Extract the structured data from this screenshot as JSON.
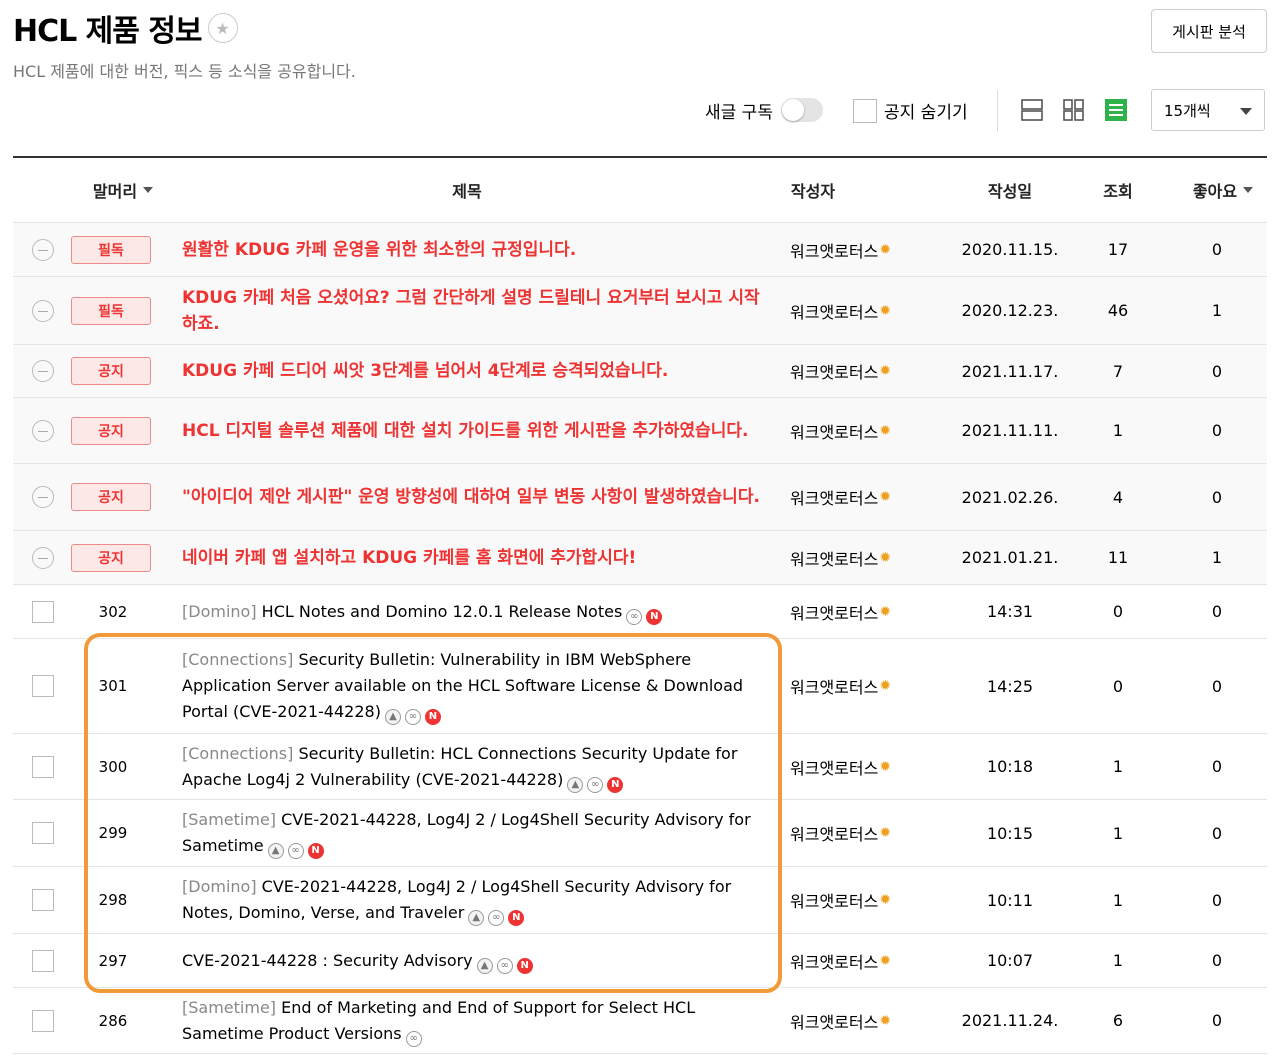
{
  "board": {
    "title": "HCL 제품 정보",
    "description": "HCL 제품에 대한 버전, 픽스 등 소식을 공유합니다.",
    "analyze_label": "게시판 분석",
    "subscribe_label": "새글 구독",
    "hide_notice_label": "공지 숨기기",
    "per_page": "15개씩"
  },
  "columns": {
    "prefix": "말머리",
    "title": "제목",
    "author": "작성자",
    "date": "작성일",
    "views": "조회",
    "likes": "좋아요"
  },
  "notices": [
    {
      "badge": "필독",
      "title": "원활한 KDUG 카페 운영을 위한 최소한의 규정입니다.",
      "author": "워크앳로터스",
      "date": "2020.11.15.",
      "views": "17",
      "likes": "0"
    },
    {
      "badge": "필독",
      "title": "KDUG 카페 처음 오셨어요? 그럼 간단하게 설명 드릴테니 요거부터 보시고 시작하죠.",
      "author": "워크앳로터스",
      "date": "2020.12.23.",
      "views": "46",
      "likes": "1"
    },
    {
      "badge": "공지",
      "title": "KDUG 카페 드디어 씨앗 3단계를 넘어서 4단계로 승격되었습니다.",
      "author": "워크앳로터스",
      "date": "2021.11.17.",
      "views": "7",
      "likes": "0"
    },
    {
      "badge": "공지",
      "title": "HCL 디지털 솔루션 제품에 대한 설치 가이드를 위한 게시판을 추가하였습니다.",
      "author": "워크앳로터스",
      "date": "2021.11.11.",
      "views": "1",
      "likes": "0"
    },
    {
      "badge": "공지",
      "title": "\"아이디어 제안 게시판\" 운영 방향성에 대하여 일부 변동 사항이 발생하였습니다.",
      "author": "워크앳로터스",
      "date": "2021.02.26.",
      "views": "4",
      "likes": "0"
    },
    {
      "badge": "공지",
      "title": "네이버 카페 앱 설치하고 KDUG 카페를 홈 화면에 추가합시다!",
      "author": "워크앳로터스",
      "date": "2021.01.21.",
      "views": "11",
      "likes": "1"
    }
  ],
  "posts": [
    {
      "num": "302",
      "head": "[Domino]",
      "title": "HCL Notes and Domino 12.0.1 Release Notes",
      "author": "워크앳로터스",
      "date": "14:31",
      "views": "0",
      "likes": "0"
    },
    {
      "num": "301",
      "head": "[Connections]",
      "title": "Security Bulletin: Vulnerability in IBM WebSphere Application Server available on the HCL Software License & Download Portal (CVE-2021-44228)",
      "author": "워크앳로터스",
      "date": "14:25",
      "views": "0",
      "likes": "0"
    },
    {
      "num": "300",
      "head": "[Connections]",
      "title": "Security Bulletin: HCL Connections Security Update for Apache Log4j 2 Vulnerability (CVE-2021-44228)",
      "author": "워크앳로터스",
      "date": "10:18",
      "views": "1",
      "likes": "0"
    },
    {
      "num": "299",
      "head": "[Sametime]",
      "title": "CVE-2021-44228, Log4J 2 / Log4Shell Security Advisory for Sametime",
      "author": "워크앳로터스",
      "date": "10:15",
      "views": "1",
      "likes": "0"
    },
    {
      "num": "298",
      "head": "[Domino]",
      "title": "CVE-2021-44228, Log4J 2 / Log4Shell Security Advisory for Notes, Domino, Verse, and Traveler",
      "author": "워크앳로터스",
      "date": "10:11",
      "views": "1",
      "likes": "0"
    },
    {
      "num": "297",
      "head": "",
      "title": "CVE-2021-44228 : Security Advisory",
      "author": "워크앳로터스",
      "date": "10:07",
      "views": "1",
      "likes": "0"
    },
    {
      "num": "286",
      "head": "[Sametime]",
      "title": "End of Marketing and End of Support for Select HCL Sametime Product Versions",
      "author": "워크앳로터스",
      "date": "2021.11.24.",
      "views": "6",
      "likes": "0"
    }
  ],
  "icons": {
    "image": "image-icon",
    "link": "link-icon",
    "new": "new-badge-icon",
    "new_letter": "N",
    "level": "sun-level-icon",
    "star": "star-icon"
  },
  "colors": {
    "notice_red": "#ee3333",
    "highlight_orange": "#f09a3a",
    "list_view_green": "#2db34a"
  }
}
